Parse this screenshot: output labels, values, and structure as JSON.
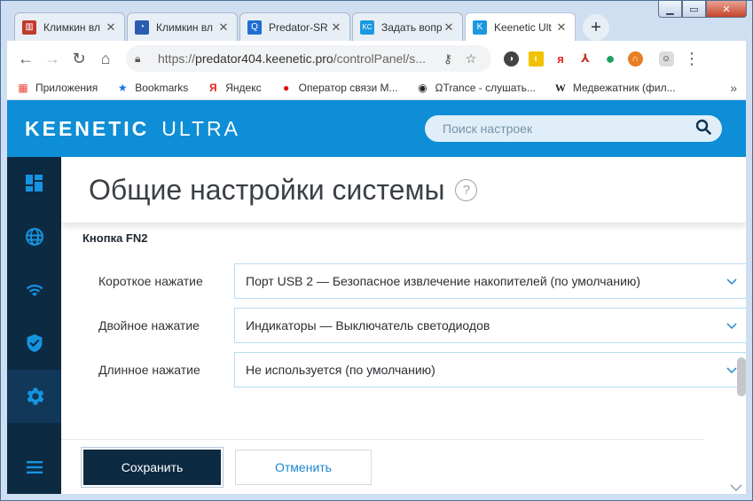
{
  "tabs": [
    {
      "title": "Климкин вл",
      "fav_color": "#c0392b",
      "fav_glyph": "▥"
    },
    {
      "title": "Климкин вл",
      "fav_color": "#2a5db0",
      "fav_glyph": "◔"
    },
    {
      "title": "Predator-SR",
      "fav_color": "#1f6fd1",
      "fav_glyph": "Q"
    },
    {
      "title": "Задать вопр",
      "fav_color": "#1b98e0",
      "fav_glyph": "KC"
    },
    {
      "title": "Keenetic Ult",
      "fav_color": "#1b98e0",
      "fav_glyph": "K"
    }
  ],
  "new_tab_label": "+",
  "toolbar": {
    "back": "←",
    "forward": "→",
    "reload": "↻",
    "home": "⌂",
    "url_scheme": "https://",
    "url_host": "predator404.keenetic.pro",
    "url_path": "/controlPanel/s...",
    "key_icon": "⚷",
    "star_icon": "☆",
    "menu_icon": "⋮"
  },
  "extensions": [
    {
      "glyph": "◑",
      "color": "#444444"
    },
    {
      "glyph": "ι",
      "color": "#f2c200"
    },
    {
      "glyph": "я",
      "color": "#e52620"
    },
    {
      "glyph": "⅄",
      "color": "#c0392b"
    },
    {
      "glyph": "●",
      "color": "#1aa260"
    },
    {
      "glyph": "∩",
      "color": "#e67e22"
    },
    {
      "glyph": "☺",
      "color": "#222222"
    }
  ],
  "bookmarks": [
    {
      "label": "Приложения",
      "icon": "▦",
      "color": "#e8453c"
    },
    {
      "label": "Bookmarks",
      "icon": "★",
      "color": "#1a73e8"
    },
    {
      "label": "Яндекс",
      "icon": "Я",
      "color": "#e52620"
    },
    {
      "label": "Оператор связи М...",
      "icon": "●",
      "color": "#e30611"
    },
    {
      "label": "ΩTrance - слушать...",
      "icon": "◉",
      "color": "#222222"
    },
    {
      "label": "Медвежатник (фил...",
      "icon": "W",
      "color": "#222222"
    }
  ],
  "bookmarks_more": "»",
  "brand": {
    "part1": "KEENETIC",
    "part2": "ULTRA",
    "header_color": "#0e8ed6",
    "sidebar_color": "#0d2a43"
  },
  "search": {
    "placeholder": "Поиск настроек"
  },
  "page": {
    "title": "Общие настройки системы",
    "help": "?",
    "section": "Кнопка FN2",
    "rows": [
      {
        "label": "Короткое нажатие",
        "value": "Порт USB 2 — Безопасное извлечение накопителей (по умолчанию)"
      },
      {
        "label": "Двойное нажатие",
        "value": "Индикаторы — Выключатель светодиодов"
      },
      {
        "label": "Длинное нажатие",
        "value": "Не используется (по умолчанию)"
      }
    ],
    "save_label": "Сохранить",
    "cancel_label": "Отменить"
  }
}
